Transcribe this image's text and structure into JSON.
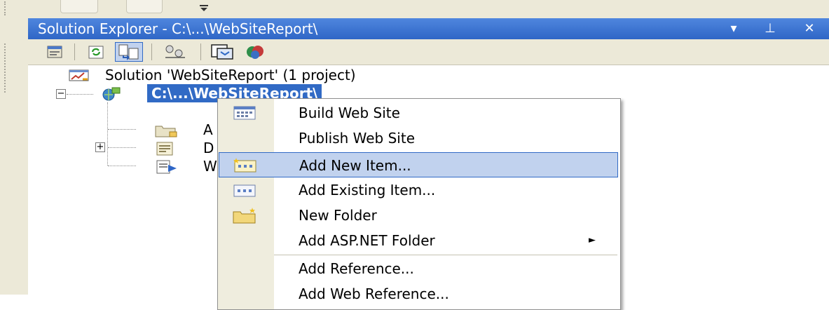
{
  "panel": {
    "title": "Solution Explorer - C:\\...\\WebSiteReport\\",
    "title_buttons": [
      "▾",
      "⊥",
      "✕"
    ]
  },
  "toolbar": {
    "buttons": [
      {
        "icon": "properties-icon"
      },
      {
        "icon": "refresh-icon"
      },
      {
        "icon": "nest-related-files-icon",
        "pressed": true
      },
      {
        "icon": "copy-web-site-icon"
      },
      {
        "icon": "view-class-diagram-icon"
      },
      {
        "icon": "asp-net-configuration-icon"
      }
    ]
  },
  "tree": {
    "solution_label": "Solution 'WebSiteReport' (1 project)",
    "project_label": "C:\\...\\WebSiteReport\\",
    "children": [
      {
        "label": "A",
        "icon": "folder-icon"
      },
      {
        "label": "D",
        "icon": "page-icon",
        "expandable": true
      },
      {
        "label": "W",
        "icon": "config-file-icon"
      }
    ]
  },
  "context_menu": {
    "items": [
      {
        "label": "Build Web Site",
        "icon": "build-icon"
      },
      {
        "label": "Publish Web Site",
        "icon": ""
      },
      {
        "label": "Add New Item...",
        "icon": "add-new-item-icon",
        "highlight": true
      },
      {
        "label": "Add Existing Item...",
        "icon": "add-existing-item-icon"
      },
      {
        "label": "New Folder",
        "icon": "new-folder-icon"
      },
      {
        "label": "Add ASP.NET Folder",
        "icon": "",
        "submenu": "►"
      },
      {
        "label": "Add Reference...",
        "icon": ""
      },
      {
        "label": "Add Web Reference...",
        "icon": ""
      }
    ]
  },
  "colors": {
    "title_bar": "#316ac5",
    "selection": "#316ac5",
    "menu_highlight": "#c1d2ee",
    "chrome": "#ece9d8"
  }
}
